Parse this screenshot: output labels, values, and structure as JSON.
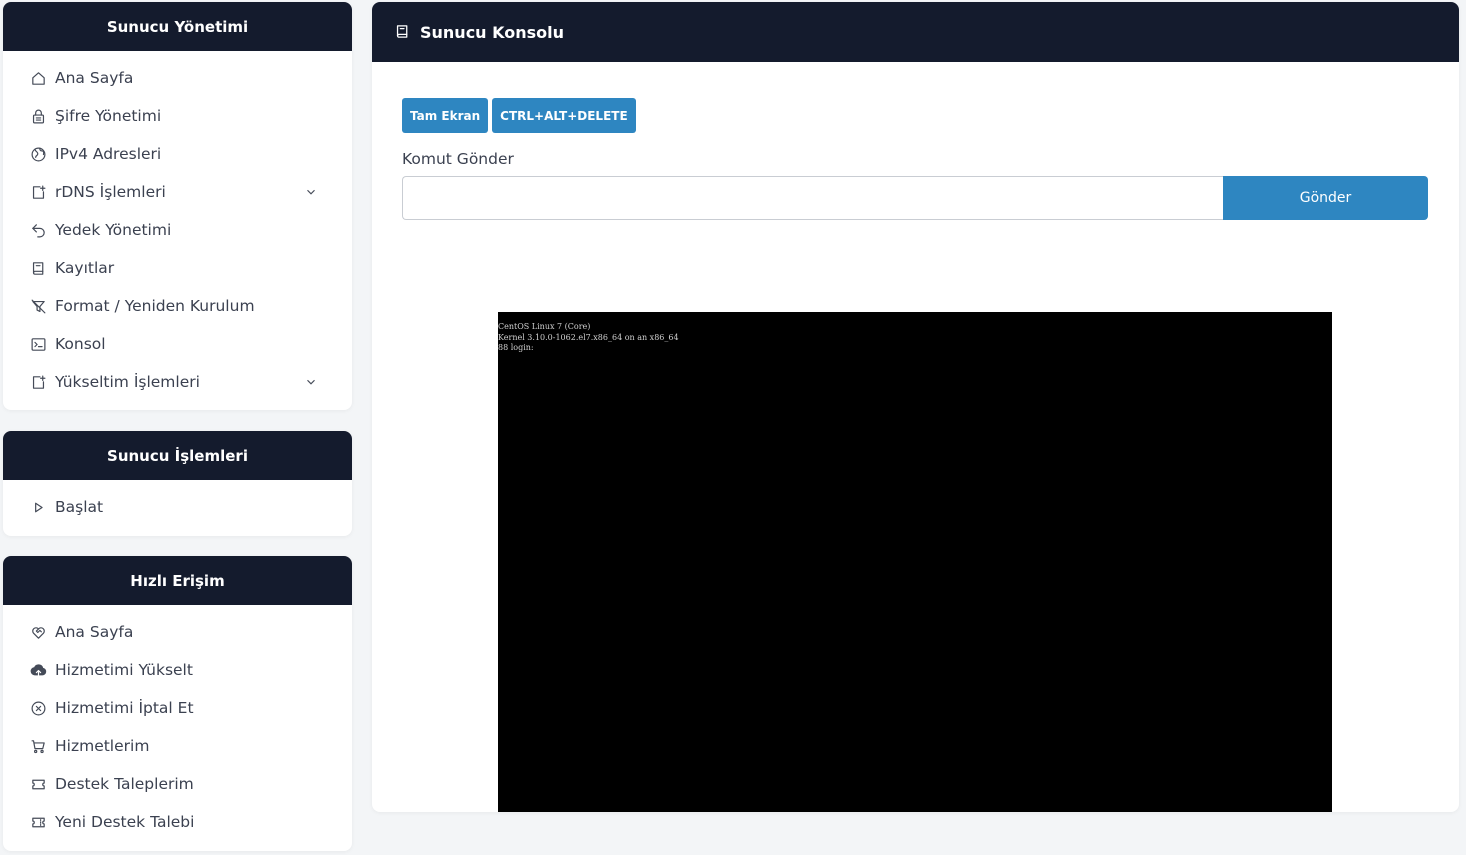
{
  "sidebar": {
    "server_management": {
      "title": "Sunucu Yönetimi",
      "items": [
        {
          "label": "Ana Sayfa",
          "icon": "home-icon"
        },
        {
          "label": "Şifre Yönetimi",
          "icon": "lock-icon"
        },
        {
          "label": "IPv4 Adresleri",
          "icon": "globe-icon"
        },
        {
          "label": "rDNS İşlemleri",
          "icon": "square-plus-icon",
          "has_chevron": true
        },
        {
          "label": "Yedek Yönetimi",
          "icon": "undo-icon"
        },
        {
          "label": "Kayıtlar",
          "icon": "book-icon"
        },
        {
          "label": "Format / Yeniden Kurulum",
          "icon": "filter-off-icon"
        },
        {
          "label": "Konsol",
          "icon": "terminal-icon"
        },
        {
          "label": "Yükseltim İşlemleri",
          "icon": "square-plus-icon",
          "has_chevron": true
        }
      ]
    },
    "server_operations": {
      "title": "Sunucu İşlemleri",
      "items": [
        {
          "label": "Başlat",
          "icon": "play-icon"
        }
      ]
    },
    "quick_access": {
      "title": "Hızlı Erişim",
      "items": [
        {
          "label": "Ana Sayfa",
          "icon": "heart-handshake-icon"
        },
        {
          "label": "Hizmetimi Yükselt",
          "icon": "cloud-upload-icon"
        },
        {
          "label": "Hizmetimi İptal Et",
          "icon": "x-circle-icon"
        },
        {
          "label": "Hizmetlerim",
          "icon": "cart-icon"
        },
        {
          "label": "Destek Taleplerim",
          "icon": "ticket-icon"
        },
        {
          "label": "Yeni Destek Talebi",
          "icon": "ticket-dashed-icon"
        }
      ]
    }
  },
  "main": {
    "title": "Sunucu Konsolu",
    "buttons": {
      "fullscreen": "Tam Ekran",
      "ctrl_alt_delete": "CTRL+ALT+DELETE"
    },
    "command": {
      "label": "Komut Gönder",
      "value": "",
      "placeholder": "",
      "send_label": "Gönder"
    },
    "console": {
      "lines": [
        "CentOS Linux 7 (Core)",
        "Kernel 3.10.0-1062.el7.x86_64 on an x86_64",
        "",
        "88 login:"
      ]
    }
  },
  "colors": {
    "header_bg": "#141b2d",
    "accent": "#2e86c1",
    "page_bg": "#f3f5f7"
  }
}
